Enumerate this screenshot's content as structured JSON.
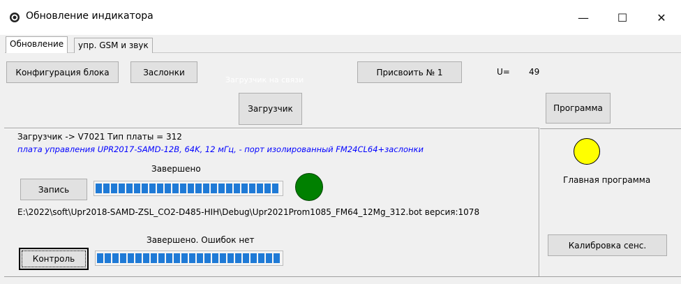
{
  "window": {
    "title": "Обновление индикатора",
    "controls": {
      "minimize": "—",
      "maximize": "☐",
      "close": "✕"
    }
  },
  "tabs": [
    {
      "label": "Обновление",
      "active": true
    },
    {
      "label": "упр. GSM и звук",
      "active": false
    }
  ],
  "toolbar": {
    "config_label": "Конфигурация блока",
    "dampers_label": "Заслонки",
    "assign_label": "Присвоить № 1",
    "u_label": "U=",
    "u_value": "49",
    "loader_status": "Загрузчик на связи",
    "loader_label": "Загрузчик",
    "program_label": "Программа"
  },
  "loader": {
    "info": "Загрузчик -> V7021   Тип платы = 312",
    "board_desc": "плата управления       UPR2017-SAMD-12B, 64K, 12 мГц, - порт изолированный FM24CL64+заслонки",
    "write_status": "Завершено",
    "write_label": "Запись",
    "write_progress": 1.0,
    "status_color": "#008000",
    "file_path": "E:\\2022\\soft\\Upr2018-SAMD-ZSL_CO2-D485-HIH\\Debug\\Upr2021Prom1085_FM64_12Mg_312.bot версия:1078",
    "check_status": "Завершено. Ошибок нет",
    "check_label": "Контроль",
    "check_progress": 1.0
  },
  "main_program": {
    "indicator_color": "#ffff00",
    "label": "Главная программа",
    "calibrate_label": "Калибровка сенс."
  },
  "colors": {
    "progress": "#1f7ad6",
    "description_text": "#0000ff"
  },
  "icons": {
    "app": "app-icon",
    "minimize": "minimize-icon",
    "maximize": "maximize-icon",
    "close": "close-icon"
  }
}
